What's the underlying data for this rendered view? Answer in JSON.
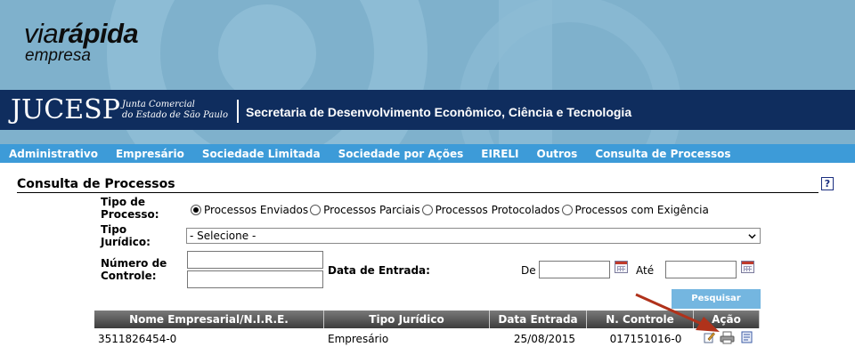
{
  "brand": {
    "logo_via": "via",
    "logo_rapida": "rápida",
    "logo_empresa": "empresa",
    "jucesp": "JUCESP",
    "junta_line1": "Junta Comercial",
    "junta_line2": "do Estado de São Paulo",
    "secretaria": "Secretaria de Desenvolvimento Econômico, Ciência e Tecnologia"
  },
  "menu": {
    "items": [
      {
        "label": "Administrativo"
      },
      {
        "label": "Empresário"
      },
      {
        "label": "Sociedade Limitada"
      },
      {
        "label": "Sociedade por Ações"
      },
      {
        "label": "EIRELI"
      },
      {
        "label": "Outros"
      },
      {
        "label": "Consulta de Processos"
      }
    ]
  },
  "page": {
    "title": "Consulta de Processos",
    "help_icon": "?"
  },
  "form": {
    "tipo_processo_label_1": "Tipo de",
    "tipo_processo_label_2": "Processo:",
    "radio_options": [
      {
        "label": "Processos Enviados",
        "checked": true
      },
      {
        "label": "Processos Parciais",
        "checked": false
      },
      {
        "label": "Processos Protocolados",
        "checked": false
      },
      {
        "label": "Processos com Exigência",
        "checked": false
      }
    ],
    "tipo_juridico_label_1": "Tipo",
    "tipo_juridico_label_2": "Jurídico:",
    "tipo_juridico_selected": "- Selecione -",
    "numero_label_1": "Número de",
    "numero_label_2": "Controle:",
    "data_entrada_label": "Data de Entrada:",
    "de_label": "De",
    "ate_label": "Até",
    "search_button": "Pesquisar"
  },
  "table": {
    "headers": [
      "Nome Empresarial/N.I.R.E.",
      "Tipo Jurídico",
      "Data Entrada",
      "N. Controle",
      "Ação"
    ],
    "rows": [
      {
        "nome": "3511826454-0",
        "tipo": "Empresário",
        "data": "25/08/2015",
        "controle": "017151016-0"
      }
    ]
  },
  "colors": {
    "banner": "#7fb1cc",
    "gov_bar": "#0f2d5e",
    "menu": "#3d9bd8",
    "button": "#74b6e0",
    "arrow": "#b0321b"
  }
}
